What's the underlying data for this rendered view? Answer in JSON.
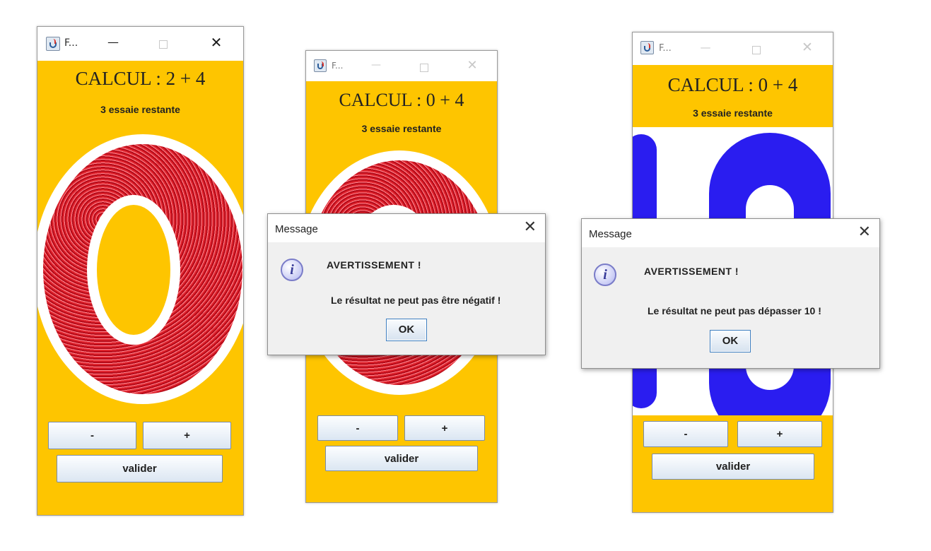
{
  "windows": [
    {
      "title": "F...",
      "calc": "CALCUL : 2 + 4",
      "tries": "3 essaie restante",
      "display_digit": "0",
      "minus_label": "-",
      "plus_label": "+",
      "validate_label": "valider"
    },
    {
      "title": "F...",
      "calc": "CALCUL : 0 + 4",
      "tries": "3 essaie restante",
      "display_digit": "0",
      "minus_label": "-",
      "plus_label": "+",
      "validate_label": "valider"
    },
    {
      "title": "F...",
      "calc": "CALCUL : 0 + 4",
      "tries": "3 essaie restante",
      "display_digit": "10",
      "minus_label": "-",
      "plus_label": "+",
      "validate_label": "valider"
    }
  ],
  "window_controls": {
    "minimize": "—",
    "close": "✕"
  },
  "dialogs": [
    {
      "title": "Message",
      "heading": "AVERTISSEMENT !",
      "message": "Le résultat ne peut pas être négatif !",
      "ok_label": "OK"
    },
    {
      "title": "Message",
      "heading": "AVERTISSEMENT !",
      "message": "Le résultat ne peut pas dépasser 10 !",
      "ok_label": "OK"
    }
  ],
  "dialog_close": "✕",
  "info_glyph": "i",
  "colors": {
    "panel_background": "#fec500",
    "glitter_red": "#c8101e",
    "digit_blue": "#2a1df0",
    "dialog_background": "#f0f0f0"
  },
  "icons": [
    "java-app-icon",
    "minimize-icon",
    "maximize-icon",
    "close-icon",
    "information-icon"
  ]
}
